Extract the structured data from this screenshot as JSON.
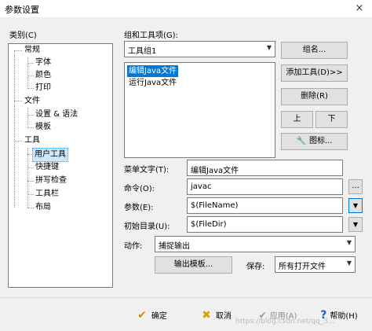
{
  "window": {
    "title": "参数设置",
    "close": "×"
  },
  "category": {
    "label": "类别(C)",
    "items": [
      {
        "label": "常规"
      },
      {
        "label": "字体"
      },
      {
        "label": "颜色"
      },
      {
        "label": "打印"
      },
      {
        "label": "文件"
      },
      {
        "label": "设置 & 语法"
      },
      {
        "label": "模板"
      },
      {
        "label": "工具"
      },
      {
        "label": "用户工具"
      },
      {
        "label": "快捷键"
      },
      {
        "label": "拼写检查"
      },
      {
        "label": "工具栏"
      },
      {
        "label": "布局"
      }
    ]
  },
  "group": {
    "label": "组和工具项(G):",
    "selected": "工具组1",
    "tools": [
      "编辑Java文件",
      "运行Java文件"
    ],
    "group_name_btn": "组名...",
    "add_tool_btn": "添加工具(D)>>",
    "delete_btn": "删除(R)",
    "up_btn": "上",
    "down_btn": "下",
    "icon_btn": "图标..."
  },
  "fields": {
    "menu_text_label": "菜单文字(T):",
    "menu_text": "编辑Java文件",
    "command_label": "命令(O):",
    "command": "javac",
    "browse": "...",
    "args_label": "参数(E):",
    "args": "$(FileName)",
    "initdir_label": "初始目录(U):",
    "initdir": "$(FileDir)"
  },
  "action": {
    "label": "动作:",
    "value": "捕捉输出",
    "output_template_btn": "输出模板...",
    "save_label": "保存:",
    "save_value": "所有打开文件"
  },
  "footer": {
    "ok": "确定",
    "cancel": "取消",
    "apply": "应用(A)",
    "help": "帮助(H)",
    "watermark": "https://blog.csdn.net/qq_3..."
  },
  "colors": {
    "selection": "#0078d7",
    "tree_selection": "#cce8ff",
    "ok_check": "#e08a00",
    "cancel_x": "#d9a300",
    "help_q": "#1f5fbf"
  }
}
